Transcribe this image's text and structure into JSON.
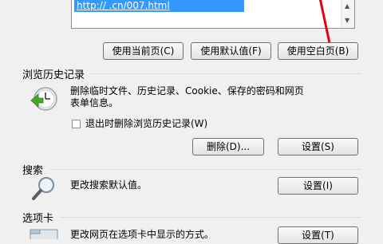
{
  "homepage": {
    "url_text": "http://                          .cn/007.html",
    "buttons": {
      "use_current": "使用当前页(C)",
      "use_default": "使用默认值(F)",
      "use_blank": "使用空白页(B)"
    }
  },
  "browsing_history": {
    "title": "浏览历史记录",
    "description_line1": "删除临时文件、历史记录、Cookie、保存的密码和网页",
    "description_line2": "表单信息。",
    "checkbox_label": "退出时删除浏览历史记录(W)",
    "checkbox_checked": false,
    "delete_button": "删除(D)...",
    "settings_button": "设置(S)"
  },
  "search": {
    "title": "搜索",
    "description": "更改搜索默认值。",
    "settings_button": "设置(I)"
  },
  "tabs": {
    "title": "选项卡",
    "description": "更改网页在选项卡中显示的方式。",
    "settings_button": "设置(T)"
  },
  "colors": {
    "annotation_arrow": "#e3000f",
    "selection": "#3399ff"
  }
}
